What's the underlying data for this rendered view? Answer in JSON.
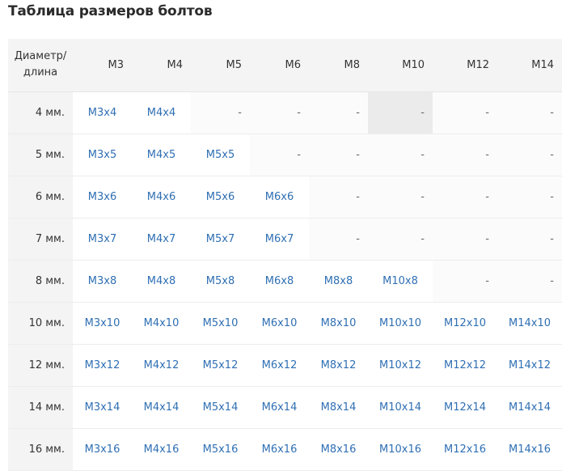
{
  "page_title": "Таблица размеров болтов",
  "table": {
    "corner_label_line1": "Диаметр/",
    "corner_label_line2": "длина",
    "columns": [
      "M3",
      "M4",
      "M5",
      "M6",
      "M8",
      "M10",
      "M12",
      "M14"
    ],
    "rows": [
      {
        "label": "4 мм.",
        "cells": [
          "M3x4",
          "M4x4",
          "-",
          "-",
          "-",
          "-",
          "-",
          "-"
        ]
      },
      {
        "label": "5 мм.",
        "cells": [
          "M3x5",
          "M4x5",
          "M5x5",
          "-",
          "-",
          "-",
          "-",
          "-"
        ]
      },
      {
        "label": "6 мм.",
        "cells": [
          "M3x6",
          "M4x6",
          "M5x6",
          "M6x6",
          "-",
          "-",
          "-",
          "-"
        ]
      },
      {
        "label": "7 мм.",
        "cells": [
          "M3x7",
          "M4x7",
          "M5x7",
          "M6x7",
          "-",
          "-",
          "-",
          "-"
        ]
      },
      {
        "label": "8 мм.",
        "cells": [
          "M3x8",
          "M4x8",
          "M5x8",
          "M6x8",
          "M8x8",
          "M10x8",
          "-",
          "-"
        ]
      },
      {
        "label": "10 мм.",
        "cells": [
          "M3x10",
          "M4x10",
          "M5x10",
          "M6x10",
          "M8x10",
          "M10x10",
          "M12x10",
          "M14x10"
        ]
      },
      {
        "label": "12 мм.",
        "cells": [
          "M3x12",
          "M4x12",
          "M5x12",
          "M6x12",
          "M8x12",
          "M10x12",
          "M12x12",
          "M14x12"
        ]
      },
      {
        "label": "14 мм.",
        "cells": [
          "M3x14",
          "M4x14",
          "M5x14",
          "M6x14",
          "M8x14",
          "M10x14",
          "M12x14",
          "M14x14"
        ]
      },
      {
        "label": "16 мм.",
        "cells": [
          "M3x16",
          "M4x16",
          "M5x16",
          "M6x16",
          "M8x16",
          "M10x16",
          "M12x16",
          "M14x16"
        ]
      }
    ]
  },
  "colors": {
    "link": "#2f6fb3",
    "header_bg": "#f4f4f4",
    "hover_bg": "#ebebeb"
  }
}
